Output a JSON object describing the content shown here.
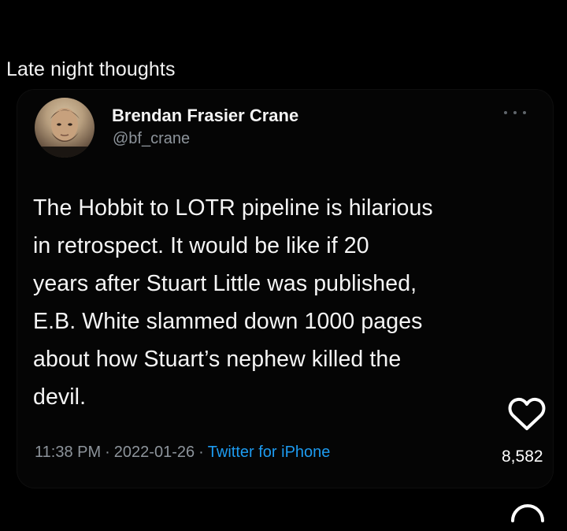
{
  "post": {
    "caption": "Late night thoughts"
  },
  "tweet": {
    "author_name": "Brendan Frasier Crane",
    "author_handle": "@bf_crane",
    "text": "The Hobbit to LOTR pipeline is hilarious\nin retrospect. It would be like if 20\nyears after Stuart Little was published,\nE.B. White slammed down 1000 pages\nabout how Stuart’s nephew killed the\ndevil.",
    "time": "11:38 PM",
    "separator": "·",
    "date": "2022-01-26",
    "source": "Twitter for iPhone"
  },
  "actions": {
    "like_count": "8,582",
    "like_icon": "heart-outline-icon",
    "comment_icon": "speech-bubble-icon",
    "more_icon": "ellipsis-icon"
  },
  "colors": {
    "background": "#000000",
    "text": "#f5f5f5",
    "secondary_text": "#8d949b",
    "link": "#1d9bf0"
  }
}
